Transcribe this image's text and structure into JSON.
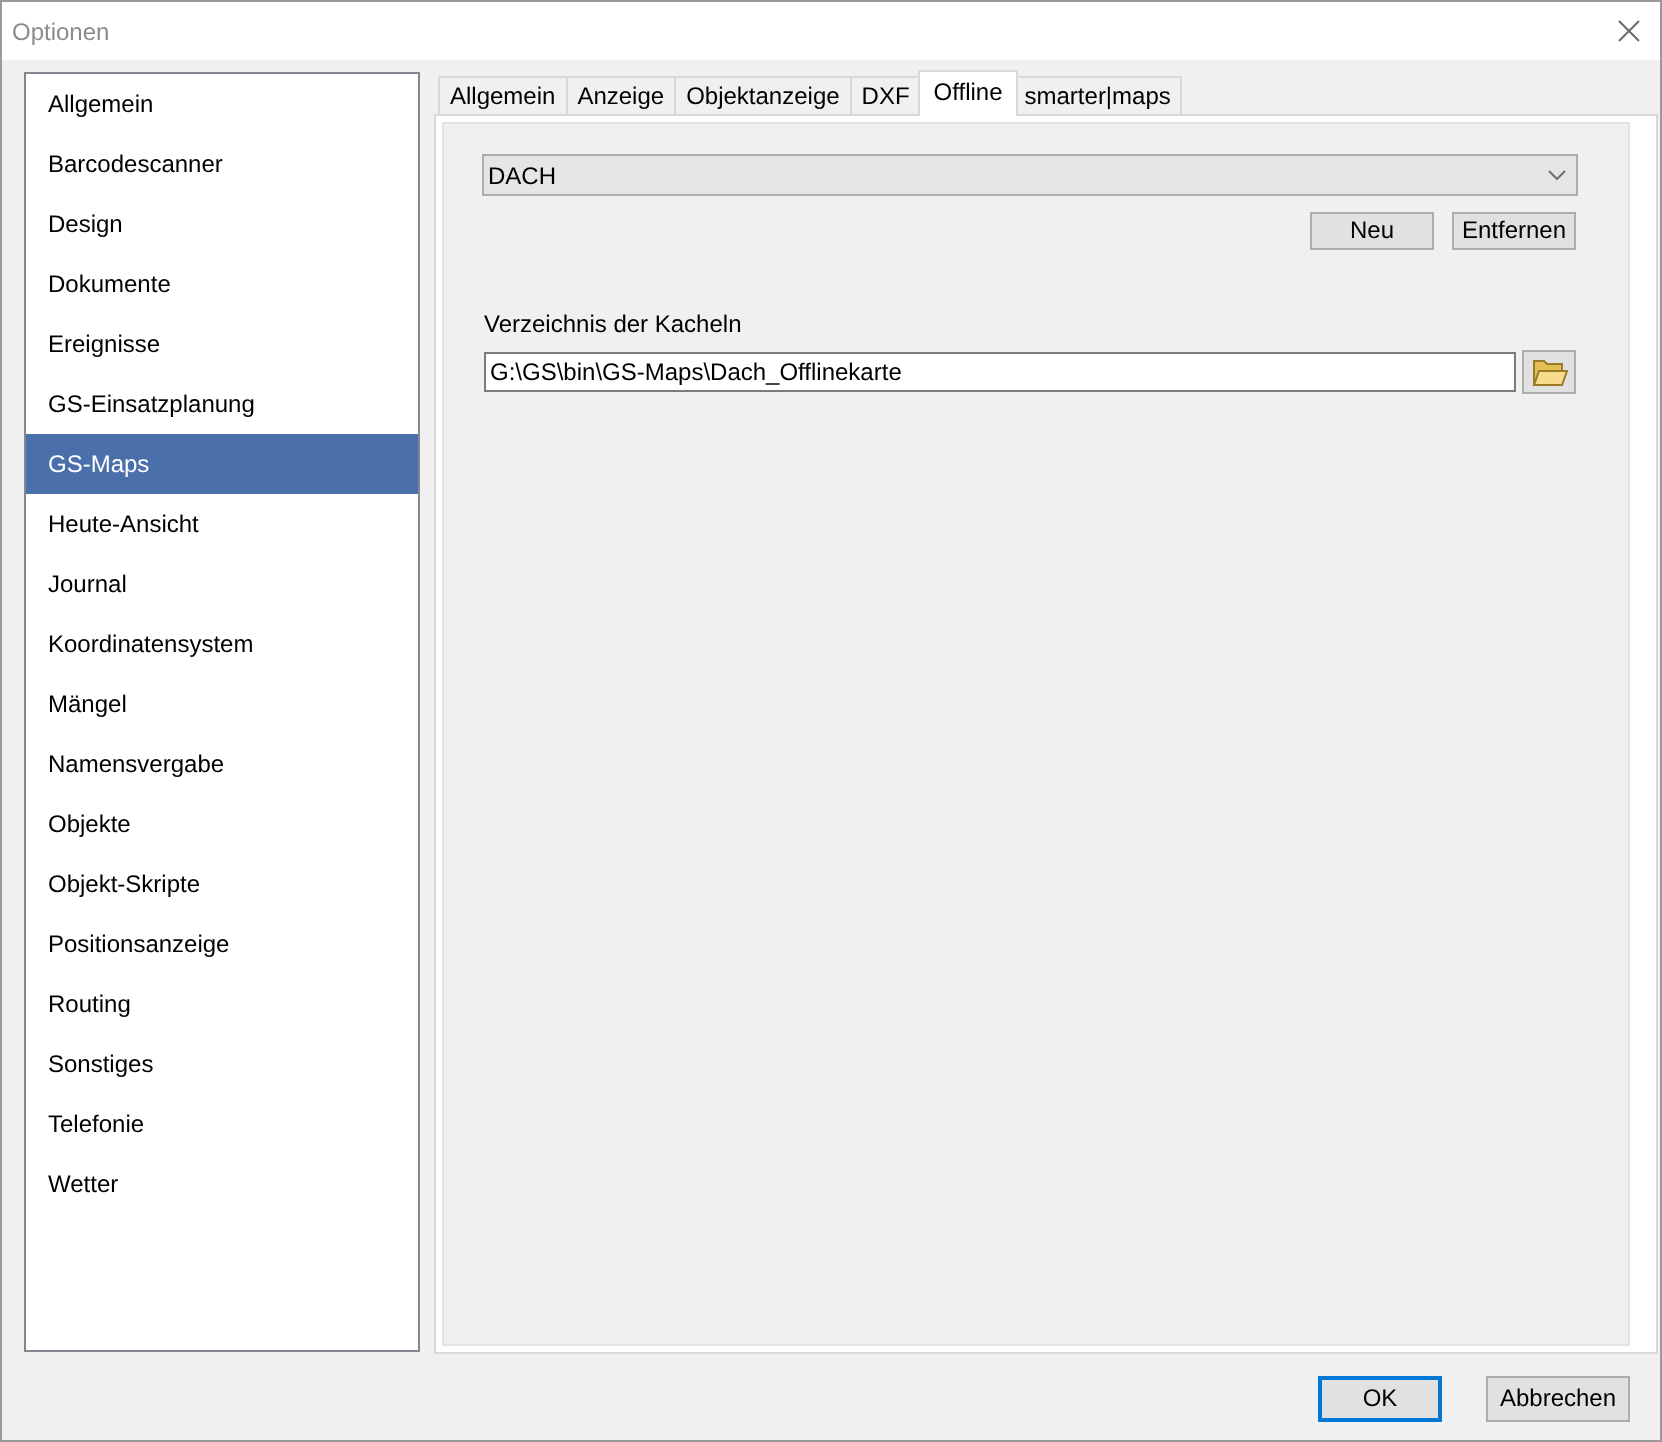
{
  "window": {
    "title": "Optionen"
  },
  "sidebar": {
    "items": [
      {
        "label": "Allgemein",
        "selected": false
      },
      {
        "label": "Barcodescanner",
        "selected": false
      },
      {
        "label": "Design",
        "selected": false
      },
      {
        "label": "Dokumente",
        "selected": false
      },
      {
        "label": "Ereignisse",
        "selected": false
      },
      {
        "label": "GS-Einsatzplanung",
        "selected": false
      },
      {
        "label": "GS-Maps",
        "selected": true
      },
      {
        "label": "Heute-Ansicht",
        "selected": false
      },
      {
        "label": "Journal",
        "selected": false
      },
      {
        "label": "Koordinatensystem",
        "selected": false
      },
      {
        "label": "Mängel",
        "selected": false
      },
      {
        "label": "Namensvergabe",
        "selected": false
      },
      {
        "label": "Objekte",
        "selected": false
      },
      {
        "label": "Objekt-Skripte",
        "selected": false
      },
      {
        "label": "Positionsanzeige",
        "selected": false
      },
      {
        "label": "Routing",
        "selected": false
      },
      {
        "label": "Sonstiges",
        "selected": false
      },
      {
        "label": "Telefonie",
        "selected": false
      },
      {
        "label": "Wetter",
        "selected": false
      }
    ]
  },
  "tabs": [
    {
      "label": "Allgemein",
      "selected": false
    },
    {
      "label": "Anzeige",
      "selected": false
    },
    {
      "label": "Objektanzeige",
      "selected": false
    },
    {
      "label": "DXF",
      "selected": false
    },
    {
      "label": "Offline",
      "selected": true
    },
    {
      "label": "smarter|maps",
      "selected": false
    }
  ],
  "offline_tab": {
    "profile": {
      "value": "DACH"
    },
    "buttons": [
      "Neu",
      "Entfernen"
    ],
    "tiles_directory": {
      "label": "Verzeichnis der Kacheln",
      "value": "G:\\GS\\bin\\GS-Maps\\Dach_Offlinekarte"
    }
  },
  "buttons": [
    {
      "label": "OK",
      "default": true
    },
    {
      "label": "Abbrechen",
      "default": false
    }
  ]
}
